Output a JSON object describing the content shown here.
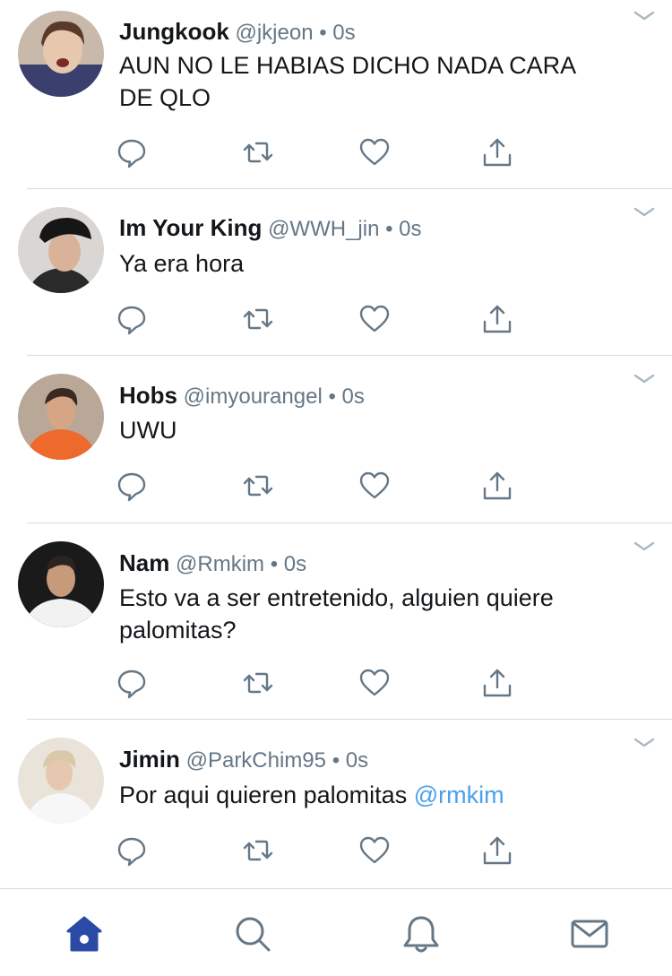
{
  "tweets": [
    {
      "name": "Jungkook",
      "handle": "@jkjeon",
      "dot": "•",
      "time": "0s",
      "lines": [
        "AUN NO LE HABIAS DICHO NADA CARA",
        "DE QLO"
      ],
      "mention": ""
    },
    {
      "name": "Im Your King",
      "handle": "@WWH_jin",
      "dot": "•",
      "time": "0s",
      "lines": [
        "Ya era hora"
      ],
      "mention": ""
    },
    {
      "name": "Hobs",
      "handle": "@imyourangel",
      "dot": "•",
      "time": "0s",
      "lines": [
        "UWU"
      ],
      "mention": ""
    },
    {
      "name": "Nam",
      "handle": "@Rmkim",
      "dot": "•",
      "time": "0s",
      "lines": [
        "Esto va a ser entretenido, alguien quiere",
        "palomitas?"
      ],
      "mention": ""
    },
    {
      "name": "Jimin",
      "handle": "@ParkChim95",
      "dot": "•",
      "time": "0s",
      "lines": [
        "Por aqui quieren palomitas "
      ],
      "mention": "@rmkim"
    }
  ],
  "icons": {
    "reply": "reply-icon",
    "retweet": "retweet-icon",
    "like": "heart-icon",
    "share": "share-icon",
    "caret": "chevron-down-icon"
  },
  "tabbar": {
    "items": [
      {
        "icon": "home-icon",
        "active": true
      },
      {
        "icon": "search-icon",
        "active": false
      },
      {
        "icon": "bell-icon",
        "active": false
      },
      {
        "icon": "mail-icon",
        "active": false
      }
    ]
  },
  "colors": {
    "text": "#14171a",
    "secondary": "#657786",
    "mention": "#4aa1eb",
    "active_tab": "#2b4aa5",
    "inactive_tab": "#657786",
    "separator": "#d6dbdf"
  }
}
